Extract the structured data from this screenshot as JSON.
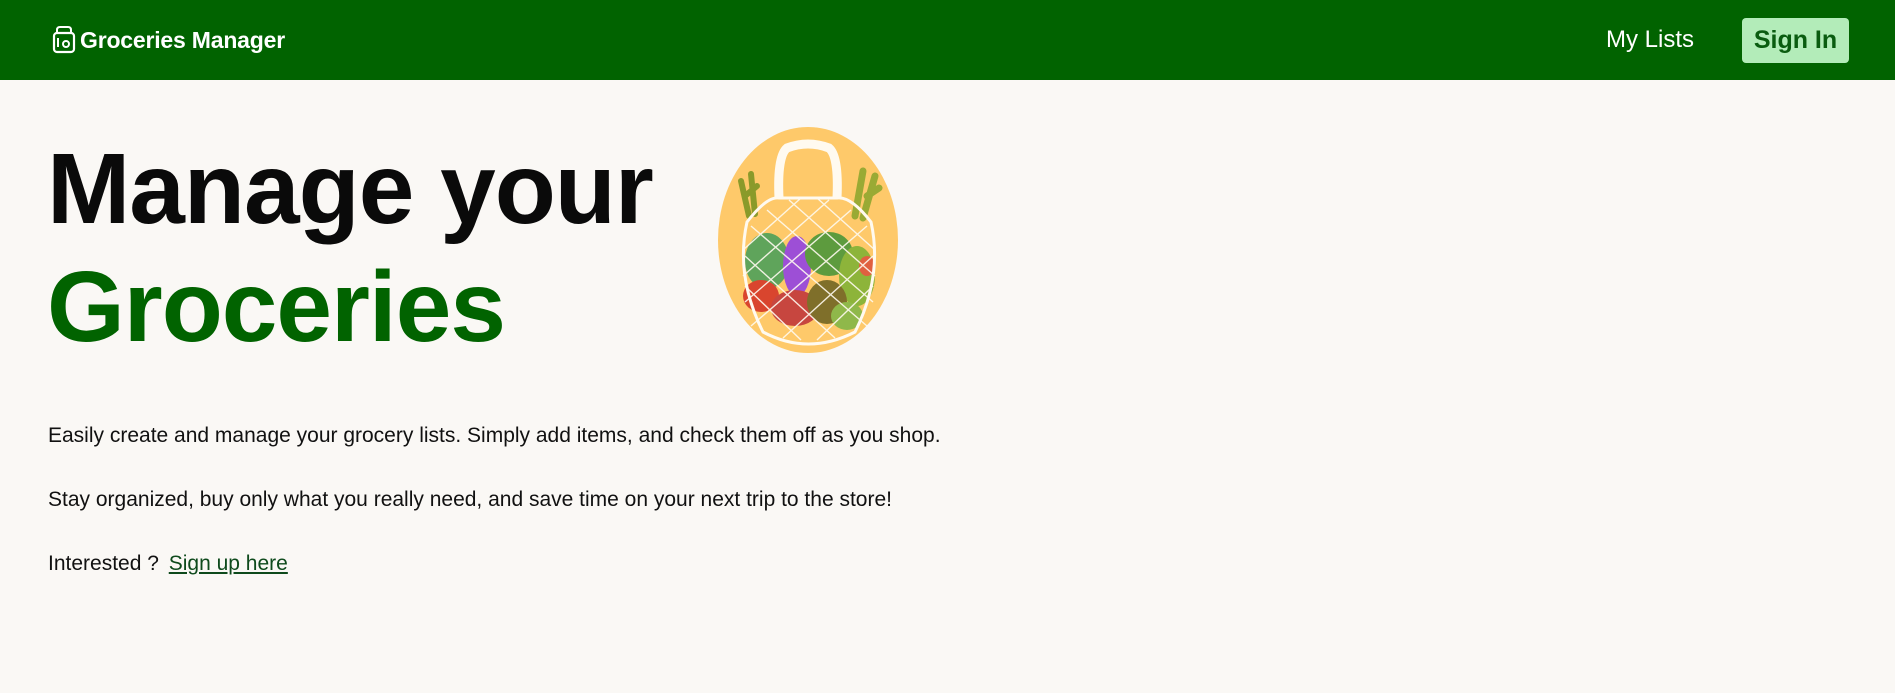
{
  "navbar": {
    "brand": "Groceries Manager",
    "brand_icon": "bag-icon",
    "my_lists": "My Lists",
    "sign_in": "Sign In",
    "background": "#016300"
  },
  "hero": {
    "line1": "Manage your",
    "line2": "Groceries",
    "accent": "#016300",
    "illustration": "grocery-net-bag-illustration"
  },
  "content": {
    "paragraph1": "Easily create and manage your grocery lists. Simply add items, and check them off as you shop.",
    "paragraph2": "Stay organized, buy only what you really need, and save time on your next trip to the store!",
    "interested": "Interested ?",
    "signup_link": "Sign up here"
  }
}
